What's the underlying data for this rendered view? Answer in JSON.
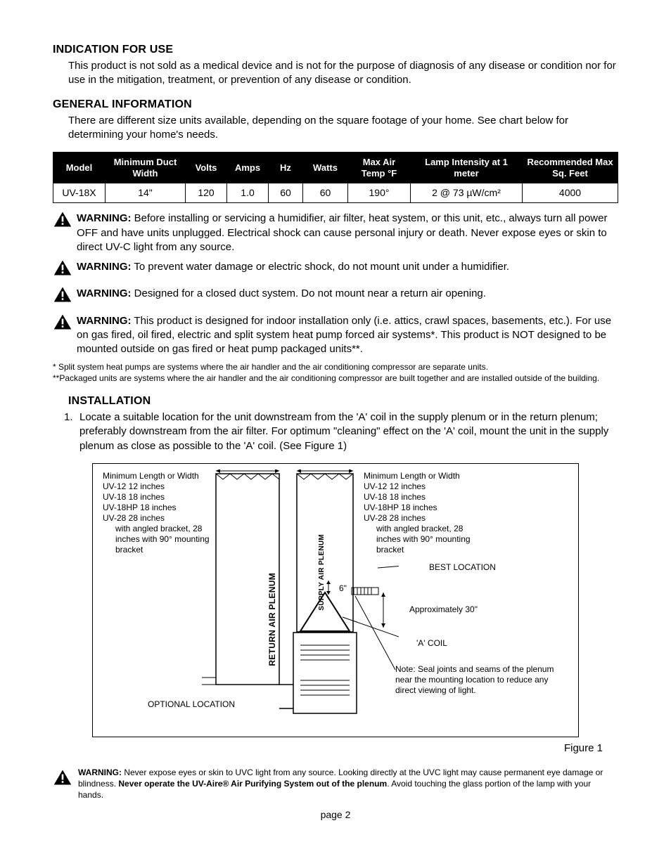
{
  "sections": {
    "indication": {
      "title": "INDICATION FOR USE",
      "body": "This product is not sold as a medical device and is not for the purpose of diagnosis of any disease or condition nor for use in the mitigation, treatment, or prevention of any disease or condition."
    },
    "general": {
      "title": "GENERAL INFORMATION",
      "body": "There are different size units available, depending on the square footage of your home. See chart below for determining your home's needs."
    },
    "installation": {
      "title": "INSTALLATION",
      "item1_num": "1.",
      "item1": "Locate a suitable location for the unit downstream from the 'A' coil in the supply plenum or in the return plenum; preferably downstream from the air filter. For optimum \"cleaning\" effect on the 'A' coil, mount the unit in the supply plenum as close as possible to the 'A' coil. (See Figure 1)"
    }
  },
  "table": {
    "headers": {
      "model": "Model",
      "minduct": "Minimum Duct Width",
      "volts": "Volts",
      "amps": "Amps",
      "hz": "Hz",
      "watts": "Watts",
      "maxair": "Max Air Temp °F",
      "lamp": "Lamp Intensity at 1 meter",
      "sqft": "Recommended Max Sq. Feet"
    },
    "row": {
      "model": "UV-18X",
      "minduct": "14\"",
      "volts": "120",
      "amps": "1.0",
      "hz": "60",
      "watts": "60",
      "maxair": "190°",
      "lamp": "2 @ 73 µW/cm²",
      "sqft": "4000"
    }
  },
  "warnings": {
    "label": "WARNING:",
    "w1": "Before installing or servicing a humidifier, air filter, heat system, or this unit, etc., always turn all power OFF and have units unplugged. Electrical shock can cause personal injury or death. Never expose eyes or skin to direct UV-C light from any source.",
    "w2": "To prevent water damage or electric shock, do not mount unit under a humidifier.",
    "w3": "Designed for a closed duct system. Do not mount near a return air opening.",
    "w4": "This product is designed for indoor installation only (i.e. attics, crawl spaces, basements, etc.). For use on gas fired, oil fired, electric and split system heat pump forced air systems*. This product is NOT designed to be mounted outside on gas fired or heat pump packaged units**.",
    "bottom_pre": "Never expose eyes or skin to UVC light from any source. Looking directly at the UVC light may cause permanent eye damage or blindness. ",
    "bottom_bold": "Never operate the UV-Aire® Air Purifying System out of the plenum",
    "bottom_post": ". Avoid touching the glass portion of the lamp with your hands."
  },
  "footnotes": {
    "f1": "*  Split system heat pumps are systems where the air handler and the air conditioning compressor are separate units.",
    "f2": "**Packaged units are systems where the air handler and the air conditioning compressor are built together and are installed outside of the building."
  },
  "figure": {
    "caption": "Figure 1",
    "min_label": "Minimum Length or Width",
    "models": {
      "uv12": "UV-12    12 inches",
      "uv18": "UV-18    18 inches",
      "uv18hp": "UV-18HP    18 inches",
      "uv28": "UV-28    28 inches"
    },
    "angled": "with angled bracket, 28 inches with 90° mounting bracket",
    "return_plenum": "RETURN AIR PLENUM",
    "supply_plenum": "SUPPLY AIR PLENUM",
    "six_inch": "6\"",
    "best": "BEST LOCATION",
    "approx": "Approximately 30\"",
    "acoil": "'A' COIL",
    "note": "Note: Seal joints and seams of the plenum near the mounting location to reduce any direct viewing of light.",
    "optional": "OPTIONAL LOCATION"
  },
  "page": "page 2"
}
